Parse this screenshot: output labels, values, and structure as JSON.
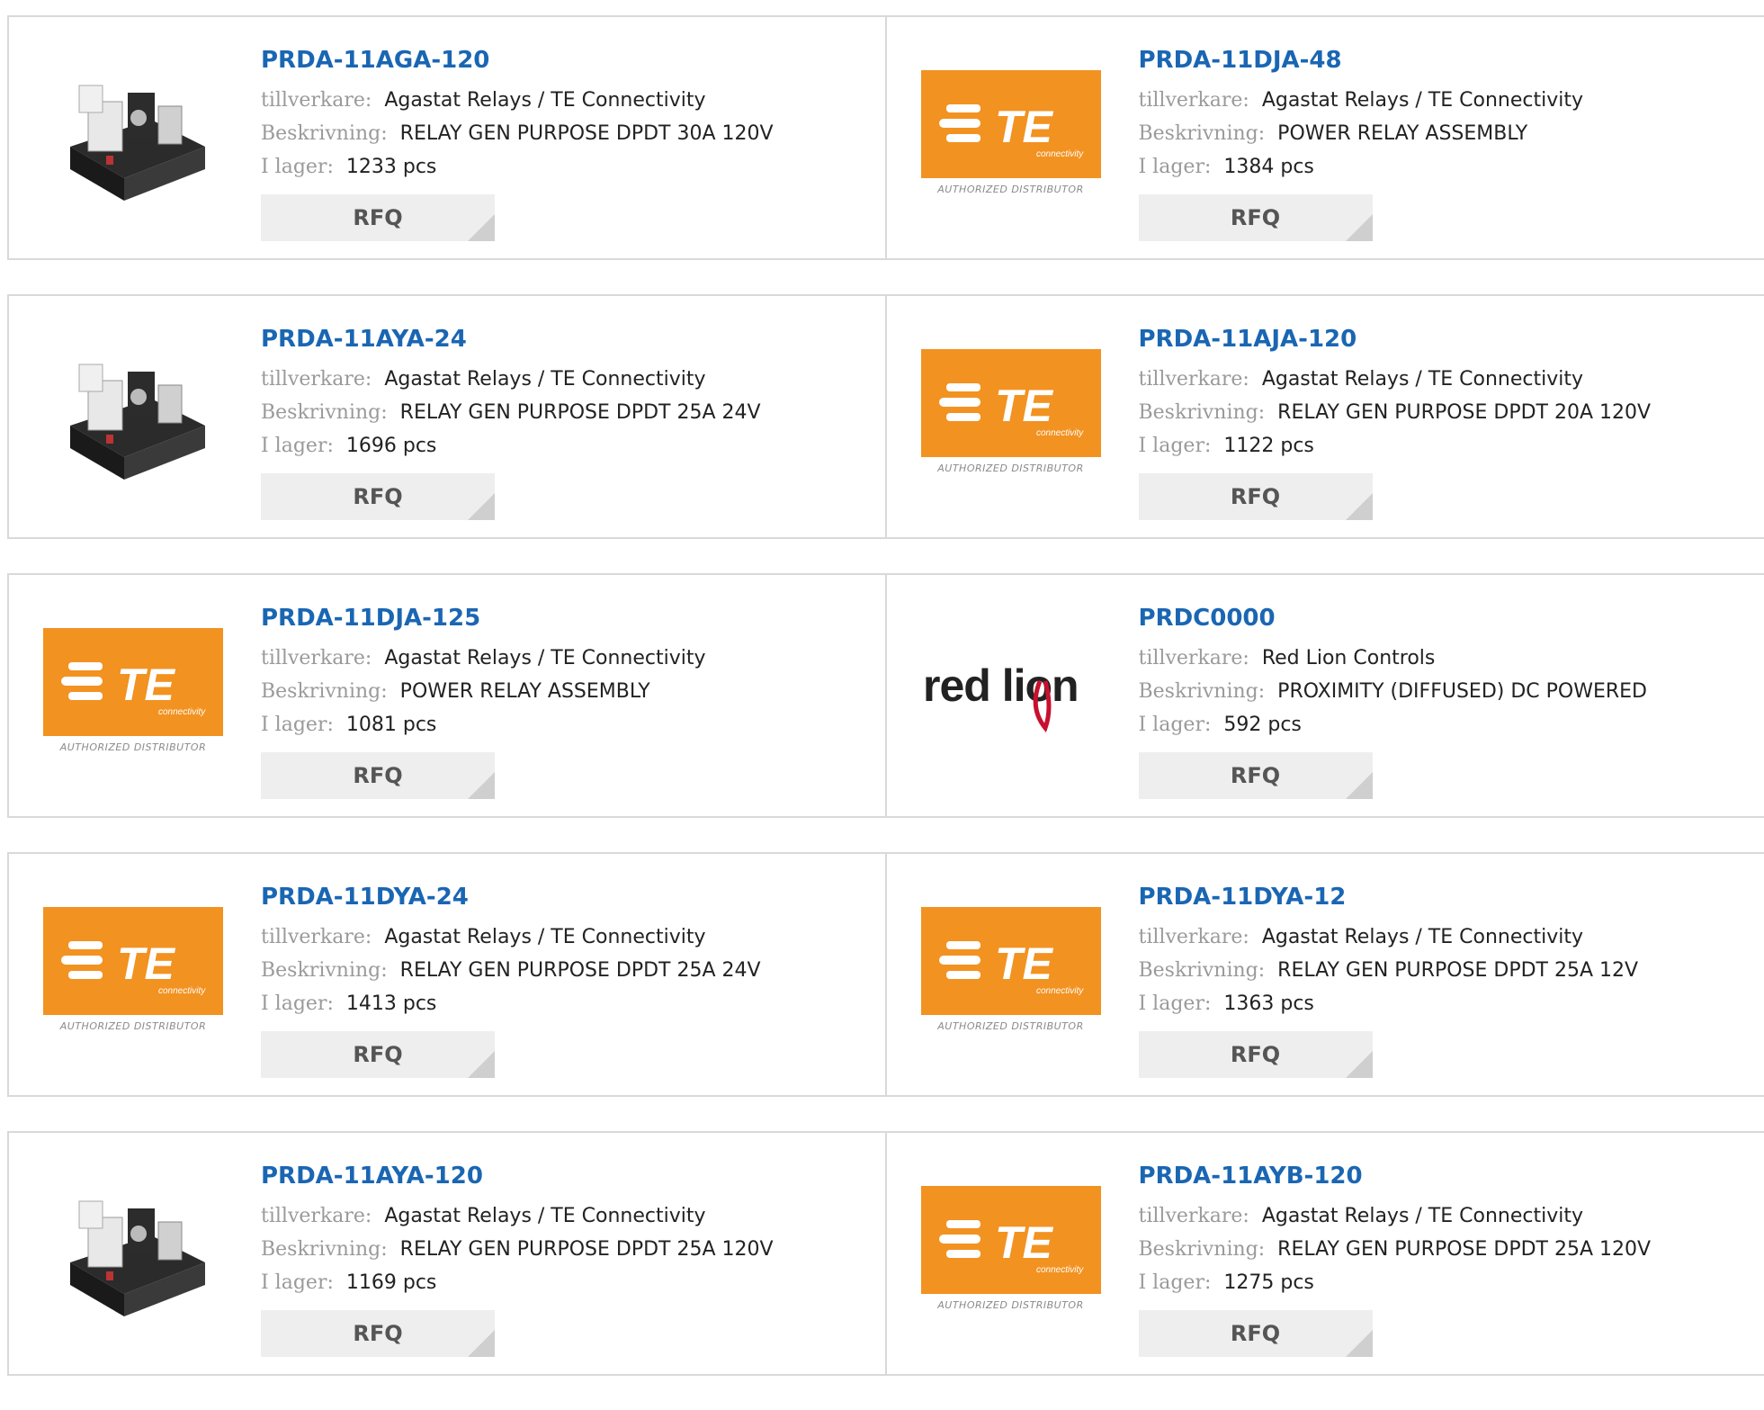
{
  "labels": {
    "manufacturer": "tillverkare:",
    "description": "Beskrivning:",
    "stock": "I lager:",
    "rfq": "RFQ"
  },
  "logo_text": {
    "te_brand": "TE",
    "te_sub": "connectivity",
    "te_caption": "AUTHORIZED DISTRIBUTOR",
    "redlion": "red lion"
  },
  "colors": {
    "link": "#1a66b3",
    "te_orange": "#f29221",
    "redlion_red": "#c8102e"
  },
  "products": [
    {
      "part": "PRDA-11AGA-120",
      "manufacturer": "Agastat Relays / TE Connectivity",
      "description": "RELAY GEN PURPOSE DPDT 30A 120V",
      "stock": "1233 pcs",
      "image": "relay-photo"
    },
    {
      "part": "PRDA-11DJA-48",
      "manufacturer": "Agastat Relays / TE Connectivity",
      "description": "POWER RELAY ASSEMBLY",
      "stock": "1384 pcs",
      "image": "te-logo"
    },
    {
      "part": "PRDA-11AYA-24",
      "manufacturer": "Agastat Relays / TE Connectivity",
      "description": "RELAY GEN PURPOSE DPDT 25A 24V",
      "stock": "1696 pcs",
      "image": "relay-photo"
    },
    {
      "part": "PRDA-11AJA-120",
      "manufacturer": "Agastat Relays / TE Connectivity",
      "description": "RELAY GEN PURPOSE DPDT 20A 120V",
      "stock": "1122 pcs",
      "image": "te-logo"
    },
    {
      "part": "PRDA-11DJA-125",
      "manufacturer": "Agastat Relays / TE Connectivity",
      "description": "POWER RELAY ASSEMBLY",
      "stock": "1081 pcs",
      "image": "te-logo"
    },
    {
      "part": "PRDC0000",
      "manufacturer": "Red Lion Controls",
      "description": "PROXIMITY (DIFFUSED) DC POWERED",
      "stock": "592 pcs",
      "image": "redlion-logo"
    },
    {
      "part": "PRDA-11DYA-24",
      "manufacturer": "Agastat Relays / TE Connectivity",
      "description": "RELAY GEN PURPOSE DPDT 25A 24V",
      "stock": "1413 pcs",
      "image": "te-logo"
    },
    {
      "part": "PRDA-11DYA-12",
      "manufacturer": "Agastat Relays / TE Connectivity",
      "description": "RELAY GEN PURPOSE DPDT 25A 12V",
      "stock": "1363 pcs",
      "image": "te-logo"
    },
    {
      "part": "PRDA-11AYA-120",
      "manufacturer": "Agastat Relays / TE Connectivity",
      "description": "RELAY GEN PURPOSE DPDT 25A 120V",
      "stock": "1169 pcs",
      "image": "relay-photo"
    },
    {
      "part": "PRDA-11AYB-120",
      "manufacturer": "Agastat Relays / TE Connectivity",
      "description": "RELAY GEN PURPOSE DPDT 25A 120V",
      "stock": "1275 pcs",
      "image": "te-logo"
    }
  ]
}
